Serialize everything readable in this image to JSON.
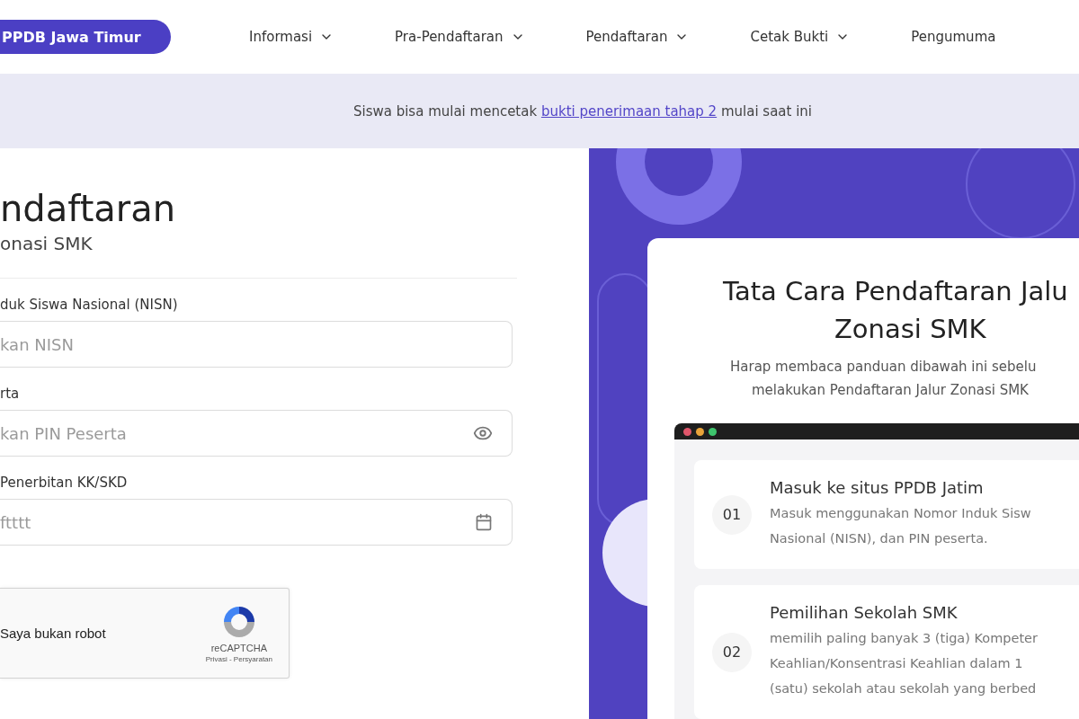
{
  "header": {
    "logo": "PPDB Jawa Timur",
    "nav": [
      {
        "label": "Informasi",
        "dropdown": true
      },
      {
        "label": "Pra-Pendaftaran",
        "dropdown": true
      },
      {
        "label": "Pendaftaran",
        "dropdown": true
      },
      {
        "label": "Cetak Bukti",
        "dropdown": true
      },
      {
        "label": "Pengumuma",
        "dropdown": false
      }
    ]
  },
  "announcement": {
    "before": "Siswa bisa mulai mencetak",
    "link": "bukti penerimaan tahap 2",
    "after": "mulai saat ini"
  },
  "form": {
    "title": "ndaftaran",
    "subtitle": "onasi SMK",
    "fields": [
      {
        "kind": "text",
        "label": "duk Siswa Nasional (NISN)",
        "placeholder": "kan NISN"
      },
      {
        "kind": "password",
        "label": "rta",
        "placeholder": "kan PIN Peserta"
      },
      {
        "kind": "date",
        "label": "Penerbitan KK/SKD",
        "placeholder": "ftttt"
      }
    ],
    "captcha": {
      "label": "Saya bukan robot",
      "brand": "reCAPTCHA",
      "links": "Privasi - Persyaratan"
    }
  },
  "guide": {
    "title_lines": [
      "Tata Cara Pendaftaran Jalu",
      "Zonasi SMK"
    ],
    "subtitle_lines": [
      "Harap membaca panduan dibawah ini sebelu",
      "melakukan Pendaftaran Jalur Zonasi SMK"
    ],
    "steps": [
      {
        "number": "01",
        "title": "Masuk ke situs PPDB Jatim",
        "lines": [
          "Masuk menggunakan Nomor Induk Sisw",
          "Nasional (NISN), dan PIN peserta."
        ]
      },
      {
        "number": "02",
        "title": "Pemilihan Sekolah SMK",
        "lines": [
          "memilih paling banyak 3 (tiga) Kompeter",
          "Keahlian/Konsentrasi Keahlian dalam 1",
          "(satu) sekolah atau sekolah yang berbed"
        ]
      }
    ]
  }
}
